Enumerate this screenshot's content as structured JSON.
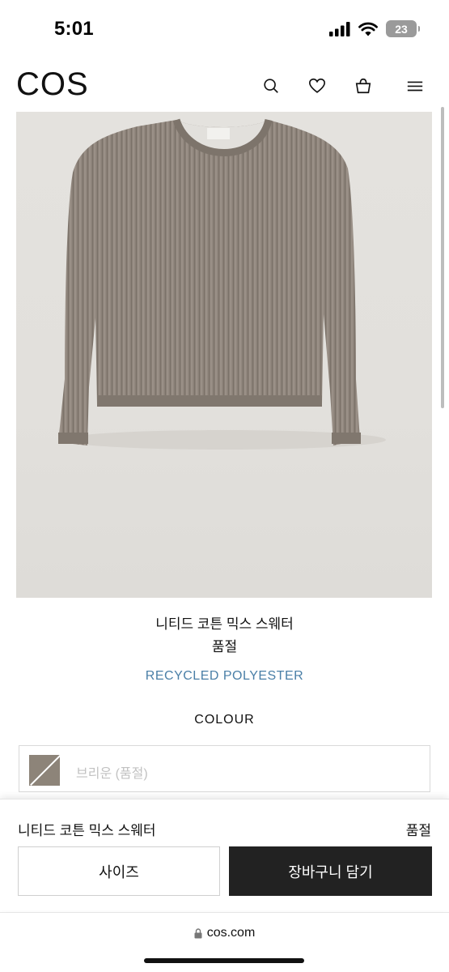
{
  "status_bar": {
    "time": "5:01",
    "battery": "23"
  },
  "header": {
    "logo": "COS",
    "icons": [
      "search-icon",
      "heart-icon",
      "bag-icon",
      "menu-icon"
    ]
  },
  "product": {
    "name": "니티드 코튼 믹스 스웨터",
    "status": "품절",
    "material": "RECYCLED POLYESTER",
    "colour_label": "COLOUR",
    "colour_value": "브리운 (품절)",
    "swatch_color": "#8d8479"
  },
  "sticky": {
    "name": "니티드 코튼 믹스 스웨터",
    "status": "품절",
    "size_button": "사이즈",
    "cart_button": "장바구니 담기"
  },
  "browser": {
    "url": "cos.com"
  }
}
